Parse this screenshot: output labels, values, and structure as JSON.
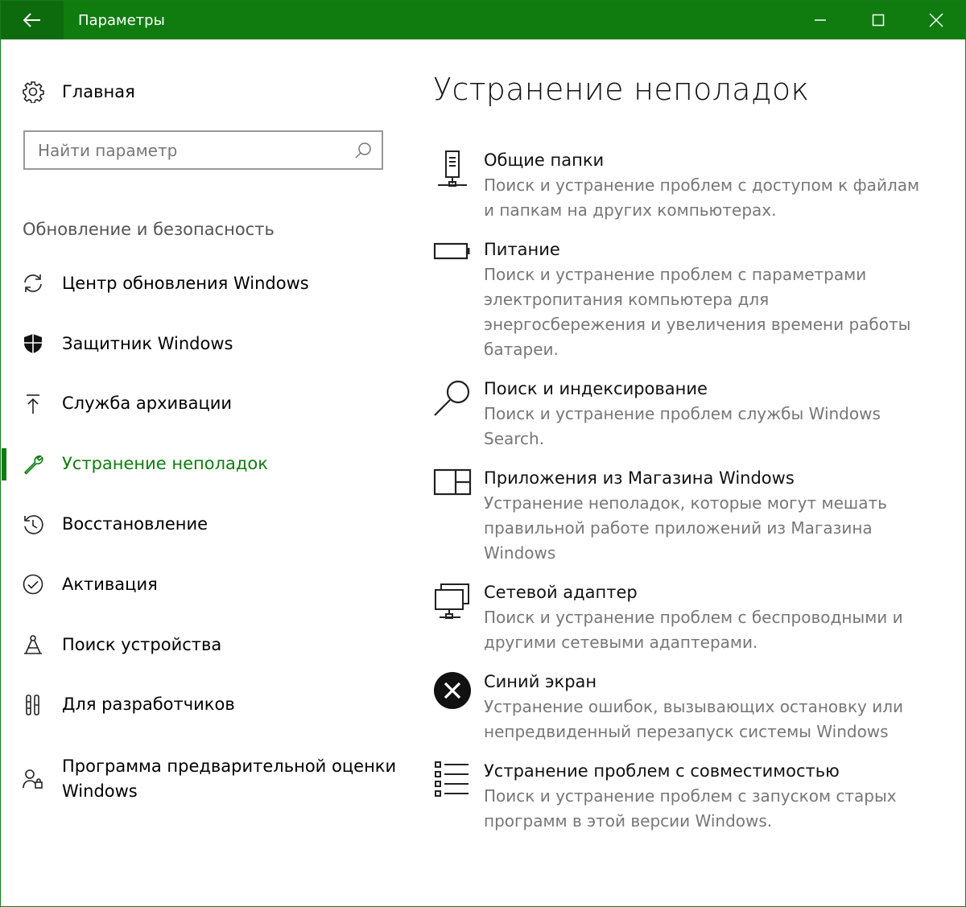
{
  "window": {
    "title": "Параметры"
  },
  "sidebar": {
    "home_label": "Главная",
    "search_placeholder": "Найти параметр",
    "section_title": "Обновление и безопасность",
    "items": [
      {
        "label": "Центр обновления Windows",
        "icon": "refresh-icon"
      },
      {
        "label": "Защитник Windows",
        "icon": "shield-icon"
      },
      {
        "label": "Служба архивации",
        "icon": "upload-arrow-icon"
      },
      {
        "label": "Устранение неполадок",
        "icon": "wrench-icon",
        "active": true
      },
      {
        "label": "Восстановление",
        "icon": "history-icon"
      },
      {
        "label": "Активация",
        "icon": "check-circle-icon"
      },
      {
        "label": "Поиск устройства",
        "icon": "find-device-icon"
      },
      {
        "label": "Для разработчиков",
        "icon": "developer-tools-icon"
      },
      {
        "label": "Программа предварительной оценки Windows",
        "icon": "insider-icon"
      }
    ]
  },
  "main": {
    "title": "Устранение неполадок",
    "items": [
      {
        "name": "Общие папки",
        "desc": "Поиск и устранение проблем с доступом к файлам и папкам на других компьютерах.",
        "icon": "shared-folders-icon"
      },
      {
        "name": "Питание",
        "desc": "Поиск и устранение проблем с параметрами электропитания компьютера для энергосбережения и увеличения  времени работы батареи.",
        "icon": "battery-icon"
      },
      {
        "name": "Поиск и индексирование",
        "desc": "Поиск и устранение проблем службы Windows Search.",
        "icon": "search-icon"
      },
      {
        "name": "Приложения из Магазина Windows",
        "desc": "Устранение неполадок, которые могут мешать правильной работе приложений из Магазина Windows",
        "icon": "store-apps-icon"
      },
      {
        "name": "Сетевой адаптер",
        "desc": "Поиск и устранение проблем с беспроводными и другими сетевыми адаптерами.",
        "icon": "network-adapter-icon"
      },
      {
        "name": "Синий экран",
        "desc": "Устранение ошибок, вызывающих остановку или непредвиденный перезапуск системы Windows",
        "icon": "error-circle-icon"
      },
      {
        "name": "Устранение проблем с совместимостью",
        "desc": "Поиск и устранение проблем с запуском старых программ в этой версии Windows.",
        "icon": "compatibility-list-icon"
      }
    ]
  },
  "colors": {
    "accent": "#107c10",
    "titlebar": "#107c10",
    "secondary_text": "#777777"
  }
}
